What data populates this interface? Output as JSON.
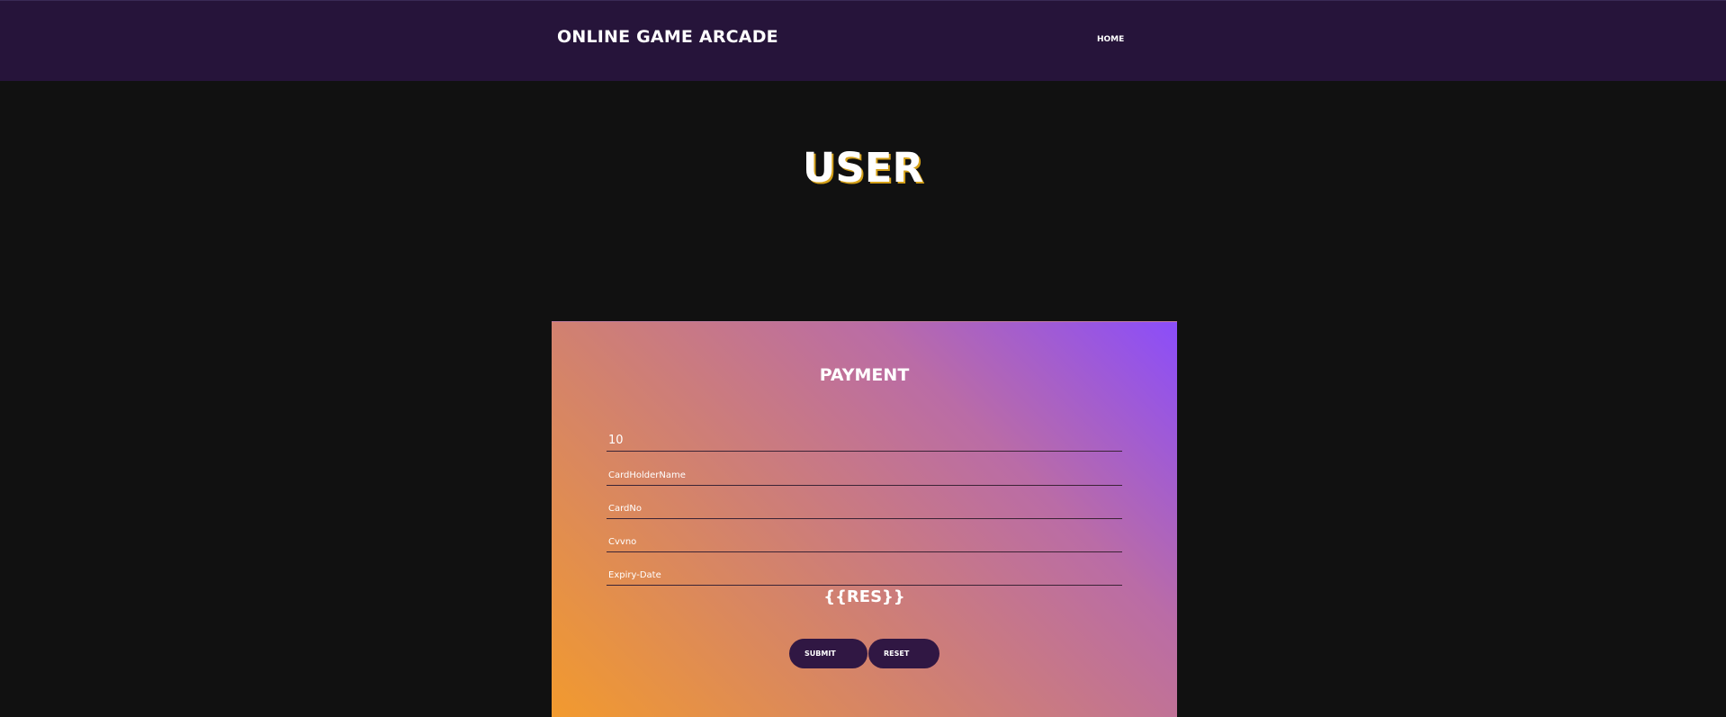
{
  "header": {
    "brand": "ONLINE GAME ARCADE",
    "nav": {
      "home_label": "HOME"
    }
  },
  "page": {
    "title": "USER"
  },
  "payment_form": {
    "title": "PAYMENT",
    "fields": {
      "amount": {
        "value": "10"
      },
      "card_holder_name": {
        "placeholder": "CardHolderName"
      },
      "card_no": {
        "placeholder": "CardNo"
      },
      "cvv_no": {
        "placeholder": "Cvvno"
      },
      "expiry_date": {
        "placeholder": "Expiry-Date"
      }
    },
    "result_text": "{{RES}}",
    "buttons": {
      "submit_label": "SUBMIT",
      "reset_label": "RESET"
    }
  },
  "colors": {
    "header_bg": "#26143a",
    "page_bg": "#111111",
    "button_bg": "#301743",
    "gradient_start": "#f29a2e",
    "gradient_end": "#8b4dfa"
  }
}
